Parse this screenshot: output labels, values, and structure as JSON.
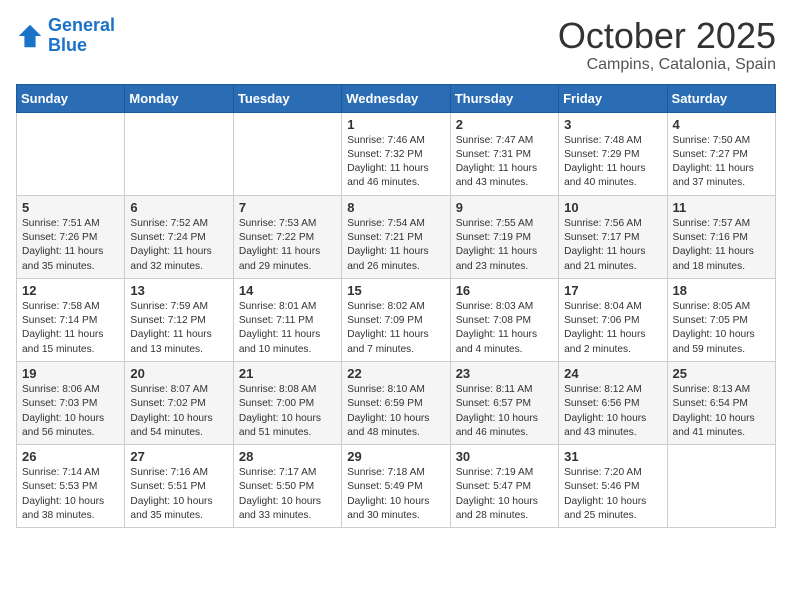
{
  "logo": {
    "line1": "General",
    "line2": "Blue"
  },
  "title": "October 2025",
  "subtitle": "Campins, Catalonia, Spain",
  "days_of_week": [
    "Sunday",
    "Monday",
    "Tuesday",
    "Wednesday",
    "Thursday",
    "Friday",
    "Saturday"
  ],
  "weeks": [
    [
      {
        "day": "",
        "content": ""
      },
      {
        "day": "",
        "content": ""
      },
      {
        "day": "",
        "content": ""
      },
      {
        "day": "1",
        "content": "Sunrise: 7:46 AM\nSunset: 7:32 PM\nDaylight: 11 hours and 46 minutes."
      },
      {
        "day": "2",
        "content": "Sunrise: 7:47 AM\nSunset: 7:31 PM\nDaylight: 11 hours and 43 minutes."
      },
      {
        "day": "3",
        "content": "Sunrise: 7:48 AM\nSunset: 7:29 PM\nDaylight: 11 hours and 40 minutes."
      },
      {
        "day": "4",
        "content": "Sunrise: 7:50 AM\nSunset: 7:27 PM\nDaylight: 11 hours and 37 minutes."
      }
    ],
    [
      {
        "day": "5",
        "content": "Sunrise: 7:51 AM\nSunset: 7:26 PM\nDaylight: 11 hours and 35 minutes."
      },
      {
        "day": "6",
        "content": "Sunrise: 7:52 AM\nSunset: 7:24 PM\nDaylight: 11 hours and 32 minutes."
      },
      {
        "day": "7",
        "content": "Sunrise: 7:53 AM\nSunset: 7:22 PM\nDaylight: 11 hours and 29 minutes."
      },
      {
        "day": "8",
        "content": "Sunrise: 7:54 AM\nSunset: 7:21 PM\nDaylight: 11 hours and 26 minutes."
      },
      {
        "day": "9",
        "content": "Sunrise: 7:55 AM\nSunset: 7:19 PM\nDaylight: 11 hours and 23 minutes."
      },
      {
        "day": "10",
        "content": "Sunrise: 7:56 AM\nSunset: 7:17 PM\nDaylight: 11 hours and 21 minutes."
      },
      {
        "day": "11",
        "content": "Sunrise: 7:57 AM\nSunset: 7:16 PM\nDaylight: 11 hours and 18 minutes."
      }
    ],
    [
      {
        "day": "12",
        "content": "Sunrise: 7:58 AM\nSunset: 7:14 PM\nDaylight: 11 hours and 15 minutes."
      },
      {
        "day": "13",
        "content": "Sunrise: 7:59 AM\nSunset: 7:12 PM\nDaylight: 11 hours and 13 minutes."
      },
      {
        "day": "14",
        "content": "Sunrise: 8:01 AM\nSunset: 7:11 PM\nDaylight: 11 hours and 10 minutes."
      },
      {
        "day": "15",
        "content": "Sunrise: 8:02 AM\nSunset: 7:09 PM\nDaylight: 11 hours and 7 minutes."
      },
      {
        "day": "16",
        "content": "Sunrise: 8:03 AM\nSunset: 7:08 PM\nDaylight: 11 hours and 4 minutes."
      },
      {
        "day": "17",
        "content": "Sunrise: 8:04 AM\nSunset: 7:06 PM\nDaylight: 11 hours and 2 minutes."
      },
      {
        "day": "18",
        "content": "Sunrise: 8:05 AM\nSunset: 7:05 PM\nDaylight: 10 hours and 59 minutes."
      }
    ],
    [
      {
        "day": "19",
        "content": "Sunrise: 8:06 AM\nSunset: 7:03 PM\nDaylight: 10 hours and 56 minutes."
      },
      {
        "day": "20",
        "content": "Sunrise: 8:07 AM\nSunset: 7:02 PM\nDaylight: 10 hours and 54 minutes."
      },
      {
        "day": "21",
        "content": "Sunrise: 8:08 AM\nSunset: 7:00 PM\nDaylight: 10 hours and 51 minutes."
      },
      {
        "day": "22",
        "content": "Sunrise: 8:10 AM\nSunset: 6:59 PM\nDaylight: 10 hours and 48 minutes."
      },
      {
        "day": "23",
        "content": "Sunrise: 8:11 AM\nSunset: 6:57 PM\nDaylight: 10 hours and 46 minutes."
      },
      {
        "day": "24",
        "content": "Sunrise: 8:12 AM\nSunset: 6:56 PM\nDaylight: 10 hours and 43 minutes."
      },
      {
        "day": "25",
        "content": "Sunrise: 8:13 AM\nSunset: 6:54 PM\nDaylight: 10 hours and 41 minutes."
      }
    ],
    [
      {
        "day": "26",
        "content": "Sunrise: 7:14 AM\nSunset: 5:53 PM\nDaylight: 10 hours and 38 minutes."
      },
      {
        "day": "27",
        "content": "Sunrise: 7:16 AM\nSunset: 5:51 PM\nDaylight: 10 hours and 35 minutes."
      },
      {
        "day": "28",
        "content": "Sunrise: 7:17 AM\nSunset: 5:50 PM\nDaylight: 10 hours and 33 minutes."
      },
      {
        "day": "29",
        "content": "Sunrise: 7:18 AM\nSunset: 5:49 PM\nDaylight: 10 hours and 30 minutes."
      },
      {
        "day": "30",
        "content": "Sunrise: 7:19 AM\nSunset: 5:47 PM\nDaylight: 10 hours and 28 minutes."
      },
      {
        "day": "31",
        "content": "Sunrise: 7:20 AM\nSunset: 5:46 PM\nDaylight: 10 hours and 25 minutes."
      },
      {
        "day": "",
        "content": ""
      }
    ]
  ]
}
